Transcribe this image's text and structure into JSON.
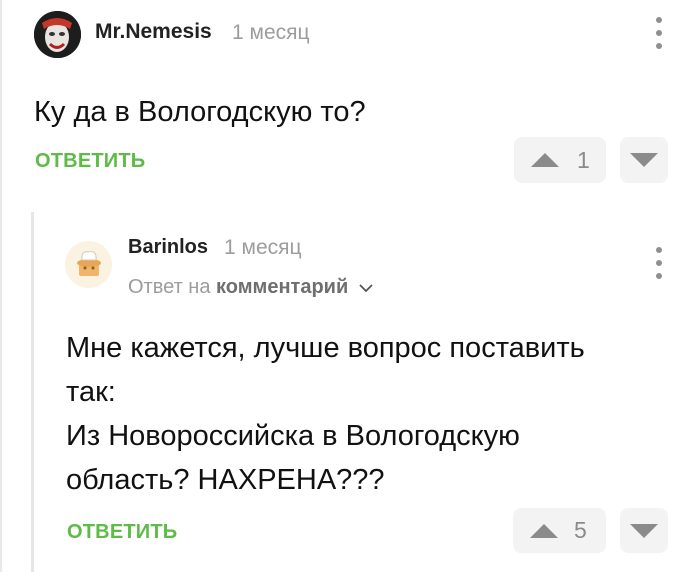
{
  "comment1": {
    "author": "Mr.Nemesis",
    "time": "1 месяц",
    "text": "Ку да в Вологодскую то?",
    "reply_label": "ОТВЕТИТЬ",
    "votes": "1"
  },
  "comment2": {
    "author": "Barinlos",
    "time": "1 месяц",
    "reply_to_prefix": "Ответ на",
    "reply_to_link": "комментарий",
    "text_line1": "Мне кажется, лучше вопрос поставить",
    "text_line2": "так:",
    "text_line3": "Из Новороссийска в Вологодскую",
    "text_line4": "область? НАХРЕНА???",
    "reply_label": "ОТВЕТИТЬ",
    "votes": "5"
  },
  "colors": {
    "accent_green": "#5dbb47",
    "muted_gray": "#9c9c9c",
    "vote_bg": "#f3f3f3"
  },
  "icons": {
    "more": "more-vertical-icon",
    "upvote": "triangle-up-icon",
    "downvote": "triangle-down-icon",
    "chevron": "chevron-down-icon"
  }
}
